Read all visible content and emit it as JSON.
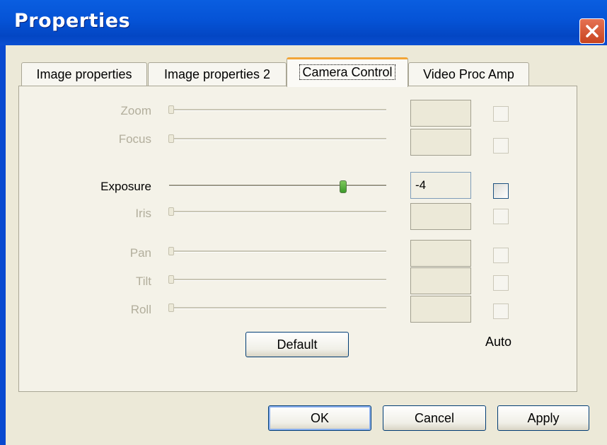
{
  "window": {
    "title": "Properties",
    "close_icon": "close-icon"
  },
  "tabs": [
    {
      "label": "Image properties",
      "active": false
    },
    {
      "label": "Image properties 2",
      "active": false
    },
    {
      "label": "Camera Control",
      "active": true
    },
    {
      "label": "Video Proc Amp",
      "active": false
    }
  ],
  "controls": [
    {
      "label": "Zoom",
      "enabled": false,
      "value": "",
      "auto": false
    },
    {
      "label": "Focus",
      "enabled": false,
      "value": "",
      "auto": false
    },
    {
      "label": "Exposure",
      "enabled": true,
      "value": "-4",
      "auto": false
    },
    {
      "label": "Iris",
      "enabled": false,
      "value": "",
      "auto": false
    },
    {
      "label": "Pan",
      "enabled": false,
      "value": "",
      "auto": false
    },
    {
      "label": "Tilt",
      "enabled": false,
      "value": "",
      "auto": false
    },
    {
      "label": "Roll",
      "enabled": false,
      "value": "",
      "auto": false
    }
  ],
  "exposure_slider_fraction": 0.8,
  "default_button": "Default",
  "auto_label": "Auto",
  "footer": {
    "ok": "OK",
    "cancel": "Cancel",
    "apply": "Apply"
  },
  "colors": {
    "titlebar": "#0553d6",
    "active_tab_accent": "#f2a537",
    "close_button": "#c8441f"
  }
}
